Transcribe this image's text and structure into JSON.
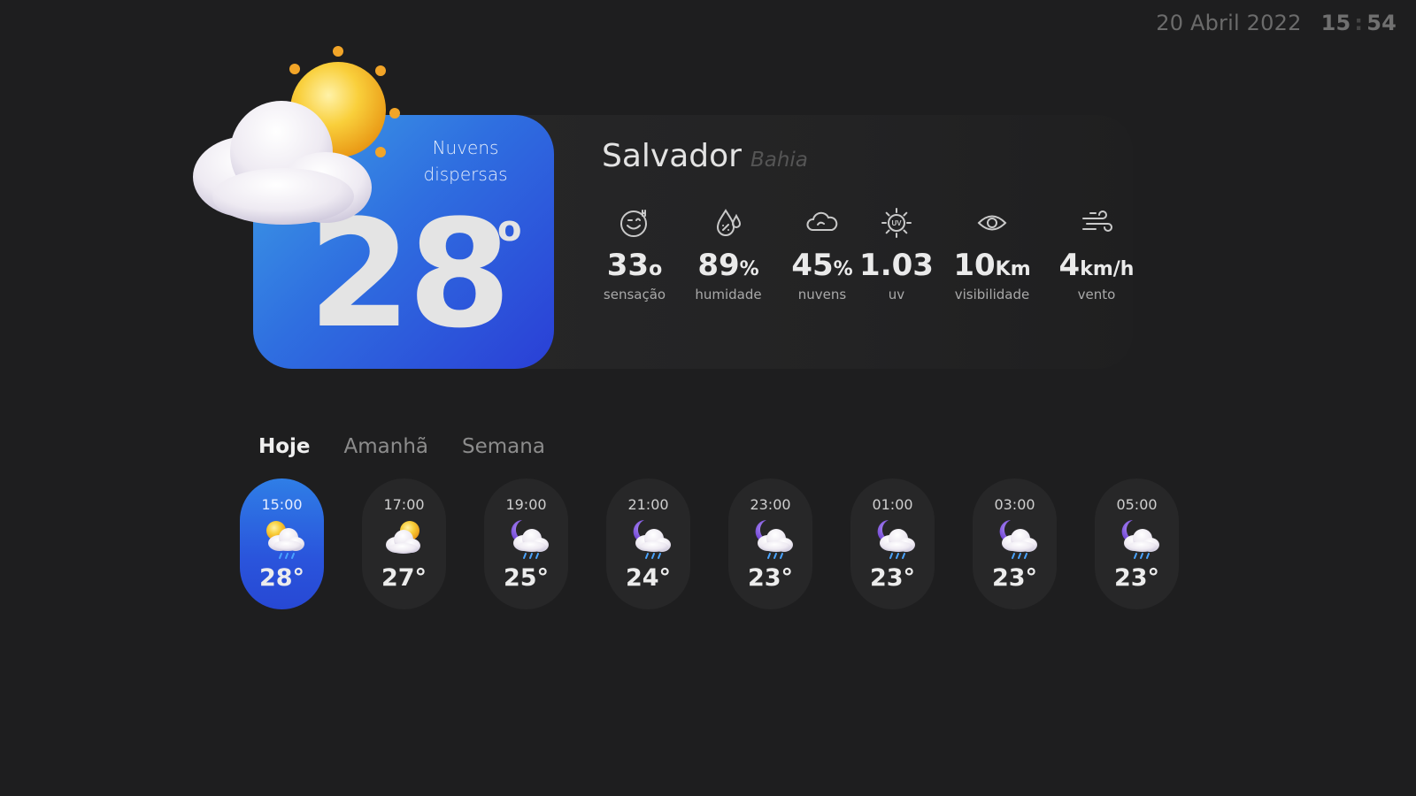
{
  "header": {
    "date": "20 Abril 2022",
    "hour": "15",
    "minute": "54"
  },
  "current": {
    "condition_line1": "Nuvens",
    "condition_line2": "dispersas",
    "temperature": "28",
    "degree_symbol": "o",
    "icon": "sun-behind-cloud-icon"
  },
  "location": {
    "city": "Salvador",
    "state": "Bahia"
  },
  "stats": [
    {
      "icon": "feels-like-face-icon",
      "value": "33",
      "unit": "o",
      "label": "sensação"
    },
    {
      "icon": "humidity-drop-icon",
      "value": "89",
      "unit": "%",
      "label": "humidade"
    },
    {
      "icon": "cloud-icon",
      "value": "45",
      "unit": "%",
      "label": "nuvens"
    },
    {
      "icon": "uv-sun-icon",
      "value": "1.03",
      "unit": "",
      "label": "uv"
    },
    {
      "icon": "eye-icon",
      "value": "10",
      "unit": "Km",
      "label": "visibilidade"
    },
    {
      "icon": "wind-icon",
      "value": "4",
      "unit": "km/h",
      "label": "vento"
    }
  ],
  "tabs": [
    {
      "label": "Hoje",
      "active": true
    },
    {
      "label": "Amanhã",
      "active": false
    },
    {
      "label": "Semana",
      "active": false
    }
  ],
  "hourly": [
    {
      "time": "15:00",
      "temp": "28°",
      "icon": "sun-cloud-rain-icon",
      "active": true
    },
    {
      "time": "17:00",
      "temp": "27°",
      "icon": "sun-behind-cloud-icon",
      "active": false
    },
    {
      "time": "19:00",
      "temp": "25°",
      "icon": "moon-cloud-rain-icon",
      "active": false
    },
    {
      "time": "21:00",
      "temp": "24°",
      "icon": "moon-cloud-rain-icon",
      "active": false
    },
    {
      "time": "23:00",
      "temp": "23°",
      "icon": "moon-cloud-rain-icon",
      "active": false
    },
    {
      "time": "01:00",
      "temp": "23°",
      "icon": "moon-cloud-rain-icon",
      "active": false
    },
    {
      "time": "03:00",
      "temp": "23°",
      "icon": "moon-cloud-rain-icon",
      "active": false
    },
    {
      "time": "05:00",
      "temp": "23°",
      "icon": "moon-cloud-rain-icon",
      "active": false
    }
  ],
  "colors": {
    "background": "#1e1e1f",
    "accent_blue": "#2f6fe0",
    "accent_light_blue": "#3ea0e6",
    "card_dark": "#272728",
    "moon_purple": "#6b3fd4",
    "sun_yellow": "#f5b820"
  }
}
